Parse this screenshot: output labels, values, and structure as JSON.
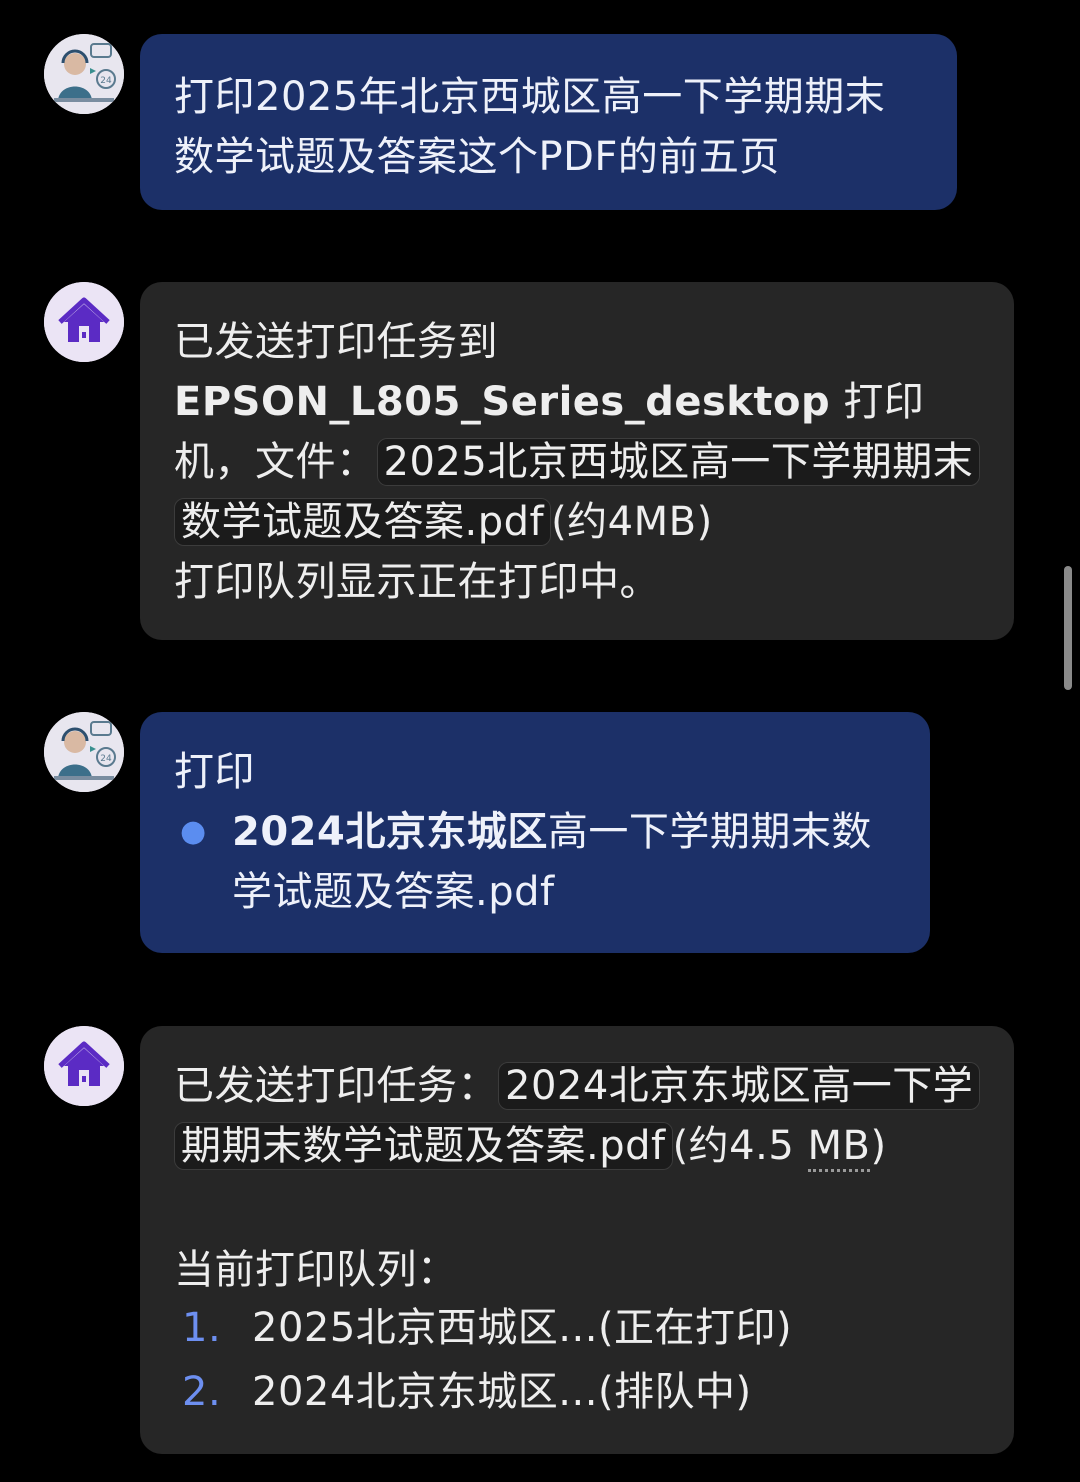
{
  "messages": [
    {
      "role": "user",
      "avatar_icon": "support-agent-icon",
      "text": "打印2025年北京西城区高一下学期期末数学试题及答案这个PDF的前五页"
    },
    {
      "role": "assistant",
      "avatar_icon": "home-icon",
      "line1": "已发送打印任务到",
      "printer": "EPSON_L805_Series_desktop",
      "printer_suffix": "打印机，文件：",
      "file": "2025北京西城区高一下学期期末数学试题及答案.pdf",
      "file_size": "(约4MB)",
      "status": "打印队列显示正在打印中。"
    },
    {
      "role": "user",
      "avatar_icon": "support-agent-icon",
      "intro": "打印",
      "item_bold": "2024北京东城区",
      "item_rest": "高一下学期期末数学试题及答案.pdf"
    },
    {
      "role": "assistant",
      "avatar_icon": "home-icon",
      "line1": "已发送打印任务：",
      "file": "2024北京东城区高一下学期期末数学试题及答案.pdf",
      "size_a": "(约4.5",
      "size_b": "MB",
      "size_c": ")",
      "queue_title": "当前打印队列：",
      "queue": [
        {
          "num": "1.",
          "text": "2025北京西城区...(正在打印)"
        },
        {
          "num": "2.",
          "text": "2024北京东城区...(排队中)"
        }
      ]
    }
  ],
  "colors": {
    "background": "#000000",
    "user_bubble": "#1c3068",
    "bot_bubble": "#262626",
    "accent": "#6d8ff0",
    "home_icon": "#5b2bc4"
  }
}
